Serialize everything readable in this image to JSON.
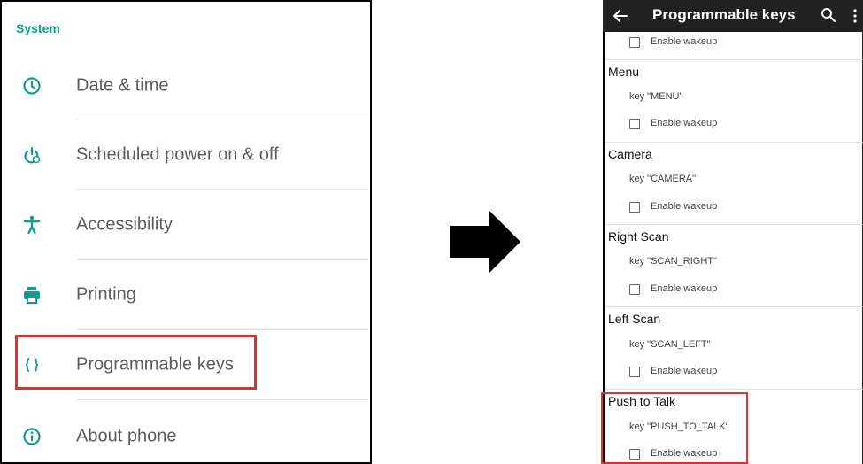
{
  "left": {
    "section_title": "System",
    "items": [
      {
        "label": "Date & time",
        "icon": "clock-icon"
      },
      {
        "label": "Scheduled power on & off",
        "icon": "power-schedule-icon"
      },
      {
        "label": "Accessibility",
        "icon": "accessibility-icon"
      },
      {
        "label": "Printing",
        "icon": "printer-icon"
      },
      {
        "label": "Programmable keys",
        "icon": "braces-icon"
      },
      {
        "label": "About phone",
        "icon": "info-icon"
      }
    ],
    "highlighted_item": "Programmable keys"
  },
  "right": {
    "appbar": {
      "title": "Programmable keys",
      "back_icon": "arrow-left-icon",
      "search_icon": "search-icon",
      "more_icon": "more-vert-icon"
    },
    "top_wakeup": "Enable wakeup",
    "keys": [
      {
        "title": "Menu",
        "code": "key \"MENU\"",
        "wakeup": "Enable wakeup"
      },
      {
        "title": "Camera",
        "code": "key \"CAMERA\"",
        "wakeup": "Enable wakeup"
      },
      {
        "title": "Right Scan",
        "code": "key \"SCAN_RIGHT\"",
        "wakeup": "Enable wakeup"
      },
      {
        "title": "Left Scan",
        "code": "key \"SCAN_LEFT\"",
        "wakeup": "Enable wakeup"
      },
      {
        "title": "Push to Talk",
        "code": "key \"PUSH_TO_TALK\"",
        "wakeup": "Enable wakeup"
      }
    ],
    "highlighted_key": "Push to Talk"
  },
  "colors": {
    "accent": "#0f9d8e",
    "highlight": "#e23030",
    "appbar": "#212121"
  }
}
